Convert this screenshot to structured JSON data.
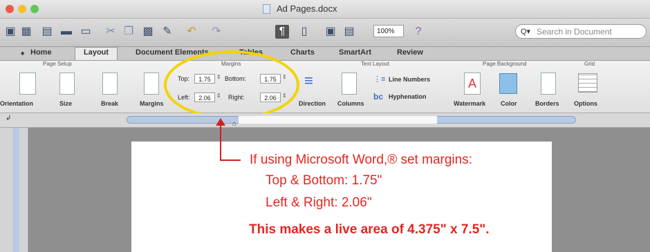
{
  "window": {
    "title": "Ad Pages.docx"
  },
  "toolbar": {
    "zoom": "100%",
    "search_placeholder": "Search in Document"
  },
  "tabs": [
    "Home",
    "Layout",
    "Document Elements",
    "Tables",
    "Charts",
    "SmartArt",
    "Review"
  ],
  "ribbon": {
    "groups": [
      "Page Setup",
      "Margins",
      "Text Layout",
      "Page Background",
      "Grid"
    ],
    "buttons": [
      "Orientation",
      "Size",
      "Break",
      "Margins",
      "Direction",
      "Columns",
      "Line Numbers",
      "Hyphenation",
      "Watermark",
      "Color",
      "Borders",
      "Options"
    ],
    "margins": {
      "top_label": "Top:",
      "top_value": "1.75",
      "bottom_label": "Bottom:",
      "bottom_value": "1.75",
      "left_label": "Left:",
      "left_value": "2.06",
      "right_label": "Right:",
      "right_value": "2.06"
    }
  },
  "annotation": {
    "line1": "If using Microsoft Word,® set margins:",
    "line2": "Top & Bottom: 1.75\"",
    "line3": "Left & Right: 2.06\"",
    "line4": "This makes a live area of 4.375\" x 7.5\"."
  },
  "colors": {
    "annotation": "#e52521",
    "highlight": "#f2d300"
  }
}
